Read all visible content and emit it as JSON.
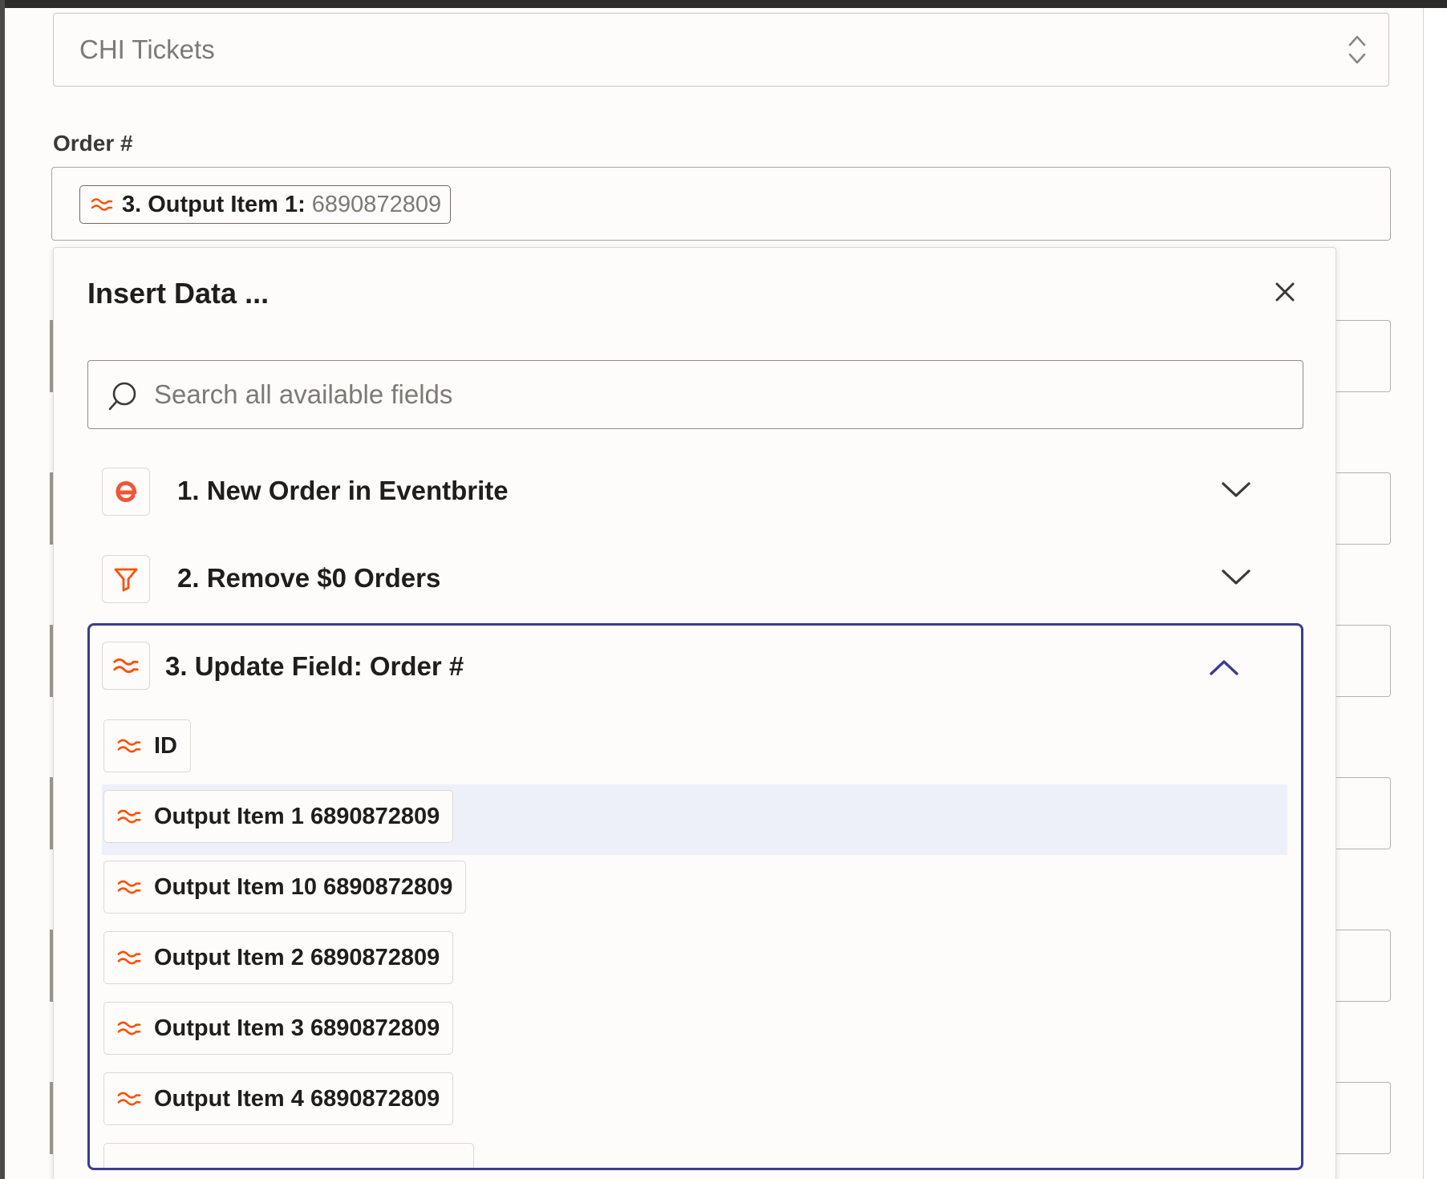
{
  "select": {
    "value": "CHI Tickets"
  },
  "order_field": {
    "label": "Order #",
    "pill_label": "3. Output Item 1:",
    "pill_value": "6890872809"
  },
  "modal": {
    "title": "Insert Data ...",
    "search_placeholder": "Search all available fields",
    "groups": [
      {
        "title": "1. New Order in Eventbrite",
        "icon": "eventbrite-icon",
        "expanded": false
      },
      {
        "title": "2. Remove $0 Orders",
        "icon": "filter-icon",
        "expanded": false
      },
      {
        "title": "3. Update Field: Order #",
        "icon": "formatter-icon",
        "expanded": true
      }
    ],
    "items": [
      {
        "label": "ID"
      },
      {
        "label": "Output Item 1 6890872809",
        "highlighted": true
      },
      {
        "label": "Output Item 10 6890872809"
      },
      {
        "label": "Output Item 2 6890872809"
      },
      {
        "label": "Output Item 3 6890872809"
      },
      {
        "label": "Output Item 4 6890872809"
      },
      {
        "label": ""
      }
    ]
  },
  "colors": {
    "accent": "#ff4f00",
    "focus": "#3b3d8c",
    "highlight": "#eef0f9"
  }
}
